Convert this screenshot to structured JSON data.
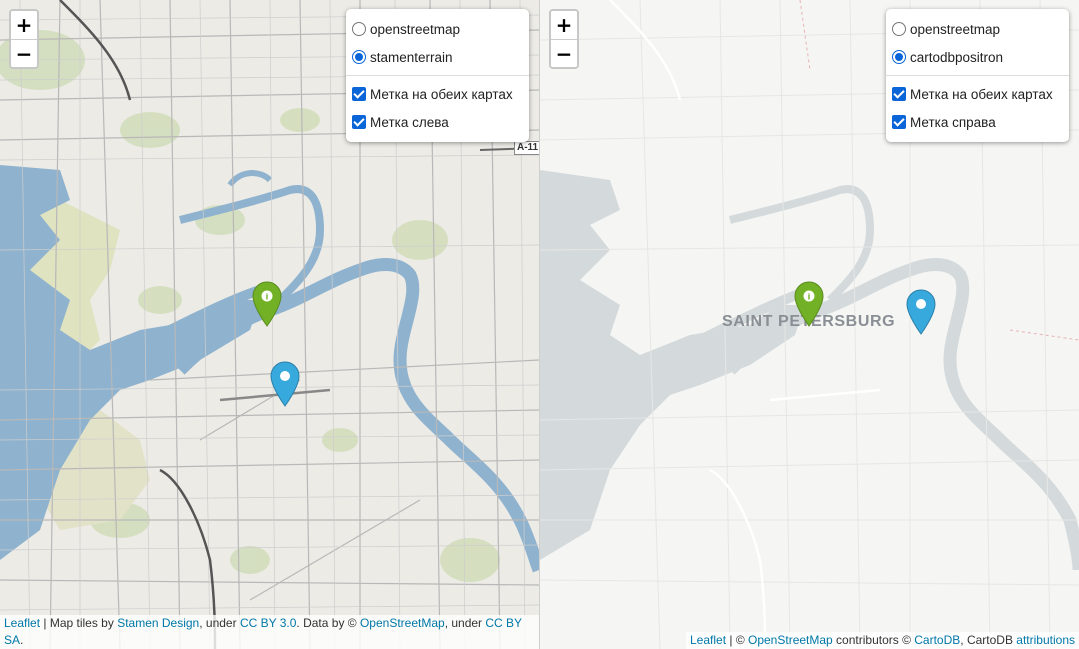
{
  "left_map": {
    "zoom_in": "+",
    "zoom_out": "−",
    "base_layers": [
      {
        "label": "openstreetmap",
        "selected": false
      },
      {
        "label": "stamenterrain",
        "selected": true
      }
    ],
    "overlays": [
      {
        "label": "Метка на обеих картах",
        "checked": true
      },
      {
        "label": "Метка слева",
        "checked": true
      }
    ],
    "road_badge": "A-11",
    "markers": [
      {
        "color": "#72b026",
        "icon": "info-icon"
      },
      {
        "color": "#38a9dc",
        "icon": "none"
      }
    ],
    "attribution": {
      "leaflet": "Leaflet",
      "sep1": " | Map tiles by ",
      "stamen": "Stamen Design",
      "sep2": ", under ",
      "ccby30": "CC BY 3.0",
      "sep3": ". Data by © ",
      "osm": "OpenStreetMap",
      "sep4": ", under ",
      "ccbysa": "CC BY SA",
      "end": "."
    }
  },
  "right_map": {
    "zoom_in": "+",
    "zoom_out": "−",
    "base_layers": [
      {
        "label": "openstreetmap",
        "selected": false
      },
      {
        "label": "cartodbpositron",
        "selected": true
      }
    ],
    "overlays": [
      {
        "label": "Метка на обеих картах",
        "checked": true
      },
      {
        "label": "Метка справа",
        "checked": true
      }
    ],
    "city_label": "SAINT PETERSBURG",
    "markers": [
      {
        "color": "#72b026",
        "icon": "info-icon"
      },
      {
        "color": "#38a9dc",
        "icon": "none"
      }
    ],
    "attribution": {
      "leaflet": "Leaflet",
      "sep1": " | © ",
      "osm": "OpenStreetMap",
      "sep2": " contributors © ",
      "cartodb": "CartoDB",
      "sep3": ", CartoDB ",
      "attributions": "attributions"
    }
  },
  "colors": {
    "water_left": "#8fb3cf",
    "water_right": "#d4dadc",
    "accent": "#0a66d8",
    "link": "#0078a8"
  }
}
